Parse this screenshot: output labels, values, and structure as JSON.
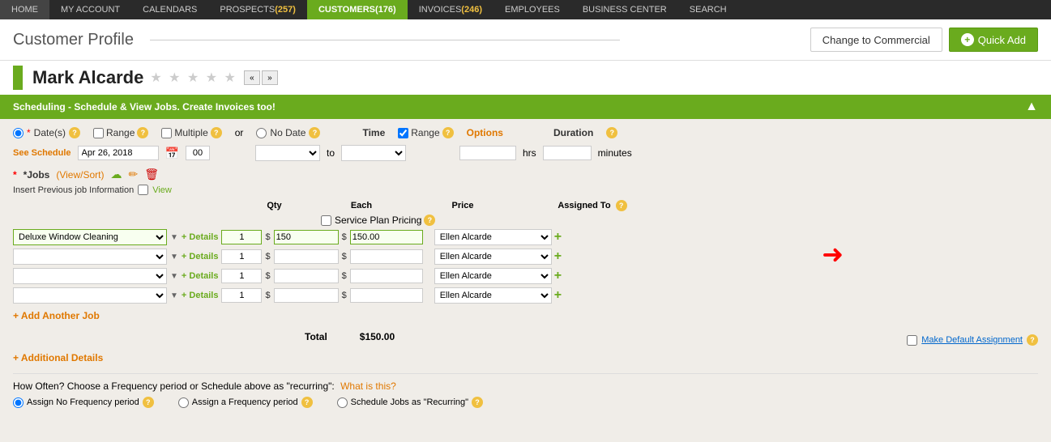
{
  "nav": {
    "items": [
      {
        "label": "HOME",
        "badge": "",
        "active": false
      },
      {
        "label": "MY ACCOUNT",
        "badge": "",
        "active": false
      },
      {
        "label": "CALENDARS",
        "badge": "",
        "active": false
      },
      {
        "label": "PROSPECTS",
        "badge": "257",
        "active": false
      },
      {
        "label": "CUSTOMERS",
        "badge": "176",
        "active": true
      },
      {
        "label": "INVOICES",
        "badge": "246",
        "active": false
      },
      {
        "label": "EMPLOYEES",
        "badge": "",
        "active": false
      },
      {
        "label": "BUSINESS CENTER",
        "badge": "",
        "active": false
      },
      {
        "label": "SEARCH",
        "badge": "",
        "active": false
      }
    ]
  },
  "page": {
    "title": "Customer Profile",
    "change_btn": "Change to Commercial",
    "quickadd_btn": "Quick Add"
  },
  "customer": {
    "name": "Mark Alcarde",
    "stars": "★ ★ ★ ★ ★"
  },
  "schedule_banner": "Scheduling - Schedule & View Jobs. Create Invoices too!",
  "form": {
    "dates_label": "Date(s)",
    "range_label": "Range",
    "multiple_label": "Multiple",
    "or_label": "or",
    "no_date_label": "No Date",
    "see_schedule": "See Schedule",
    "date_value": "Apr 26, 2018",
    "time_label": "Time",
    "range2_label": "Range",
    "options_label": "Options",
    "to_label": "to",
    "duration_label": "Duration",
    "hrs_label": "hrs",
    "minutes_label": "minutes",
    "jobs_label": "*Jobs",
    "view_sort": "(View/Sort)",
    "insert_prev": "Insert Previous job Information",
    "view_link": "View",
    "qty_header": "Qty",
    "each_header": "Each",
    "service_plan_label": "Service Plan Pricing",
    "price_header": "Price",
    "assigned_to_header": "Assigned To",
    "job_rows": [
      {
        "job": "Deluxe Window Cleaning",
        "qty": "1",
        "each": "150",
        "price": "150.00",
        "assigned": "Ellen Alcarde",
        "highlight": true
      },
      {
        "job": "",
        "qty": "1",
        "each": "",
        "price": "",
        "assigned": "Ellen Alcarde",
        "highlight": false
      },
      {
        "job": "",
        "qty": "1",
        "each": "",
        "price": "",
        "assigned": "Ellen Alcarde",
        "highlight": false
      },
      {
        "job": "",
        "qty": "1",
        "each": "",
        "price": "",
        "assigned": "Ellen Alcarde",
        "highlight": false
      }
    ],
    "add_job_label": "+ Add Another Job",
    "total_label": "Total",
    "total_value": "$150.00",
    "make_default_label": "Make Default Assignment",
    "additional_details_label": "+ Additional Details",
    "frequency_question": "How Often? Choose a Frequency period or Schedule above as \"recurring\":",
    "what_is_this": "What is this?",
    "freq_options": [
      {
        "label": "Assign No Frequency period"
      },
      {
        "label": "Assign a Frequency period"
      },
      {
        "label": "Schedule Jobs as \"Recurring\""
      }
    ]
  }
}
